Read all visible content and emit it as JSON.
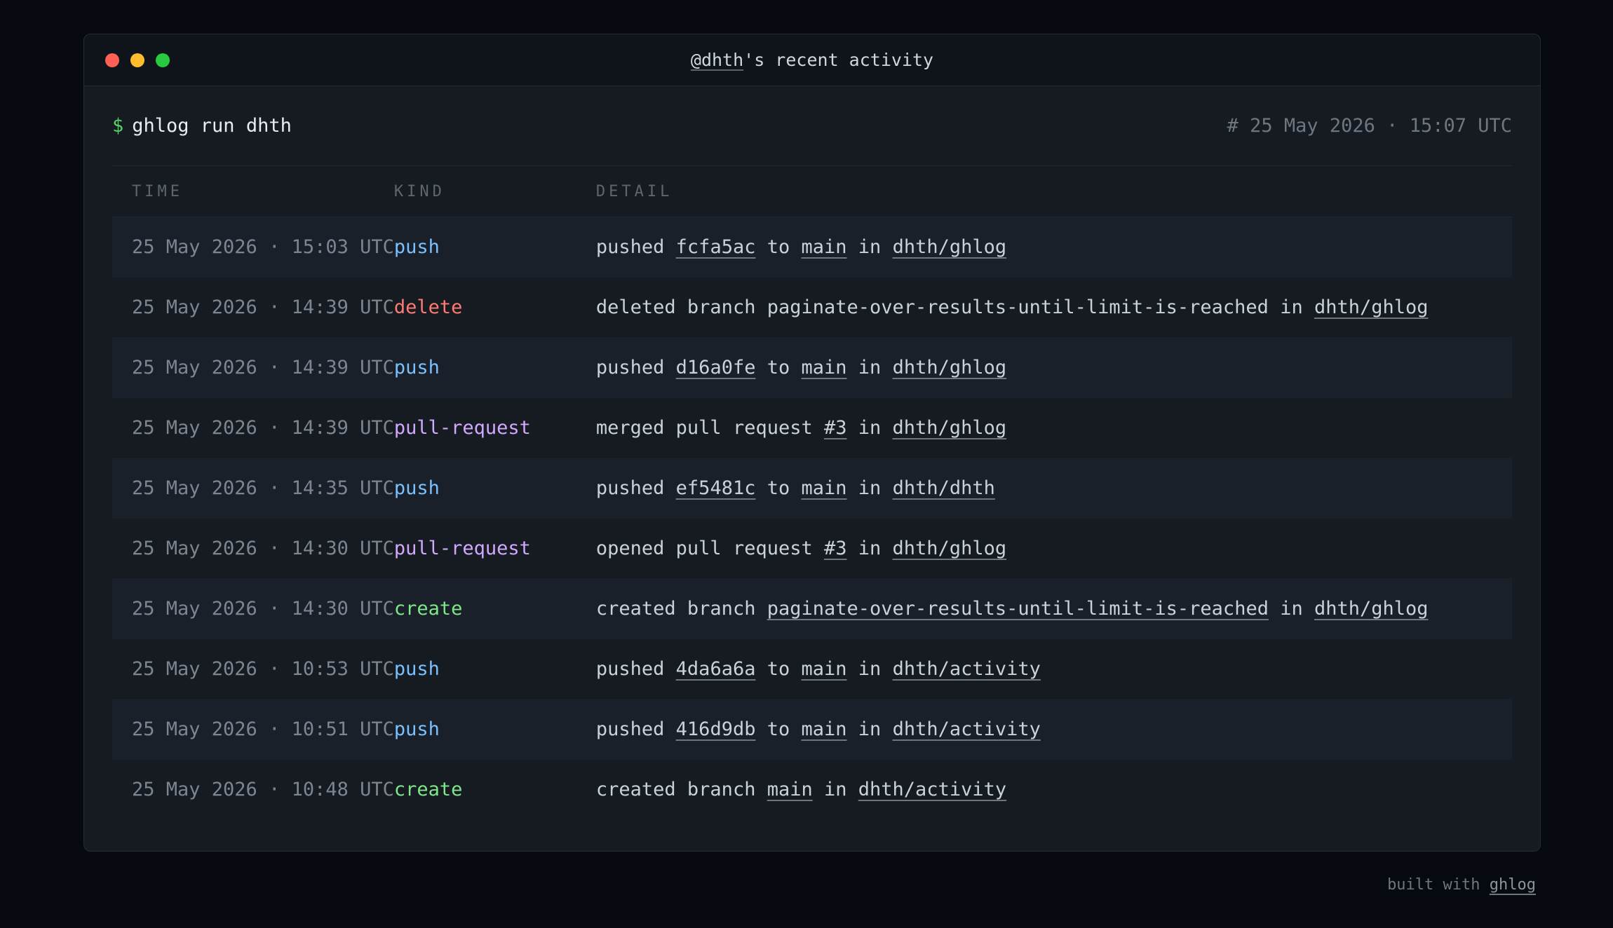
{
  "window": {
    "title_user": "@dhth",
    "title_rest": "'s recent activity"
  },
  "colors": {
    "push": "#79c0ff",
    "delete": "#ff7b72",
    "pull-request": "#d2a8ff",
    "create": "#7ee787",
    "prompt": "#56d364"
  },
  "prompt": {
    "symbol": "$",
    "command": "ghlog run dhth",
    "generated_at": "# 25 May 2026 · 15:07 UTC"
  },
  "table": {
    "headers": [
      "TIME",
      "KIND",
      "DETAIL"
    ],
    "rows": [
      {
        "time": "25 May 2026 · 15:03 UTC",
        "kind": "push",
        "detail": [
          {
            "t": "pushed "
          },
          {
            "t": "fcfa5ac",
            "link": true
          },
          {
            "t": " to "
          },
          {
            "t": "main",
            "link": true
          },
          {
            "t": " in "
          },
          {
            "t": "dhth/ghlog",
            "link": true
          }
        ]
      },
      {
        "time": "25 May 2026 · 14:39 UTC",
        "kind": "delete",
        "detail": [
          {
            "t": "deleted branch paginate-over-results-until-limit-is-reached in "
          },
          {
            "t": "dhth/ghlog",
            "link": true
          }
        ]
      },
      {
        "time": "25 May 2026 · 14:39 UTC",
        "kind": "push",
        "detail": [
          {
            "t": "pushed "
          },
          {
            "t": "d16a0fe",
            "link": true
          },
          {
            "t": " to "
          },
          {
            "t": "main",
            "link": true
          },
          {
            "t": " in "
          },
          {
            "t": "dhth/ghlog",
            "link": true
          }
        ]
      },
      {
        "time": "25 May 2026 · 14:39 UTC",
        "kind": "pull-request",
        "detail": [
          {
            "t": "merged pull request "
          },
          {
            "t": "#3",
            "link": true
          },
          {
            "t": " in "
          },
          {
            "t": "dhth/ghlog",
            "link": true
          }
        ]
      },
      {
        "time": "25 May 2026 · 14:35 UTC",
        "kind": "push",
        "detail": [
          {
            "t": "pushed "
          },
          {
            "t": "ef5481c",
            "link": true
          },
          {
            "t": " to "
          },
          {
            "t": "main",
            "link": true
          },
          {
            "t": " in "
          },
          {
            "t": "dhth/dhth",
            "link": true
          }
        ]
      },
      {
        "time": "25 May 2026 · 14:30 UTC",
        "kind": "pull-request",
        "detail": [
          {
            "t": "opened pull request "
          },
          {
            "t": "#3",
            "link": true
          },
          {
            "t": " in "
          },
          {
            "t": "dhth/ghlog",
            "link": true
          }
        ]
      },
      {
        "time": "25 May 2026 · 14:30 UTC",
        "kind": "create",
        "detail": [
          {
            "t": "created branch "
          },
          {
            "t": "paginate-over-results-until-limit-is-reached",
            "link": true
          },
          {
            "t": " in "
          },
          {
            "t": "dhth/ghlog",
            "link": true
          }
        ]
      },
      {
        "time": "25 May 2026 · 10:53 UTC",
        "kind": "push",
        "detail": [
          {
            "t": "pushed "
          },
          {
            "t": "4da6a6a",
            "link": true
          },
          {
            "t": " to "
          },
          {
            "t": "main",
            "link": true
          },
          {
            "t": " in "
          },
          {
            "t": "dhth/activity",
            "link": true
          }
        ]
      },
      {
        "time": "25 May 2026 · 10:51 UTC",
        "kind": "push",
        "detail": [
          {
            "t": "pushed "
          },
          {
            "t": "416d9db",
            "link": true
          },
          {
            "t": " to "
          },
          {
            "t": "main",
            "link": true
          },
          {
            "t": " in "
          },
          {
            "t": "dhth/activity",
            "link": true
          }
        ]
      },
      {
        "time": "25 May 2026 · 10:48 UTC",
        "kind": "create",
        "detail": [
          {
            "t": "created branch "
          },
          {
            "t": "main",
            "link": true
          },
          {
            "t": " in "
          },
          {
            "t": "dhth/activity",
            "link": true
          }
        ]
      }
    ]
  },
  "footer": {
    "prefix": "built with ",
    "link": "ghlog"
  }
}
